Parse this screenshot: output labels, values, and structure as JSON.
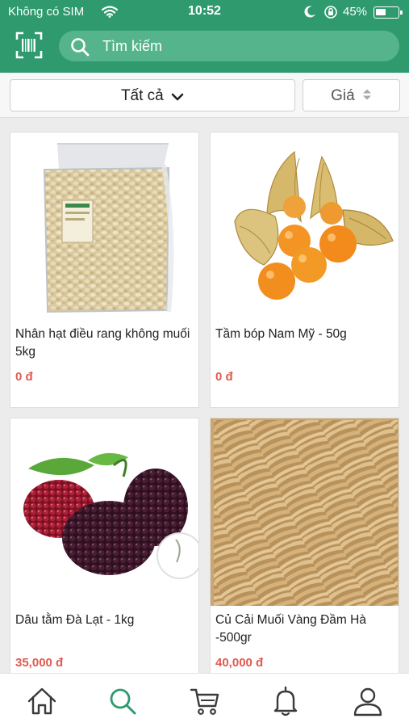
{
  "status_bar": {
    "carrier": "Không có SIM",
    "time": "10:52",
    "battery": "45%",
    "battery_level": 0.45
  },
  "header": {
    "search_placeholder": "Tìm kiếm",
    "scan_icon": "barcode-scan-icon",
    "search_icon": "search-icon"
  },
  "filters": {
    "category_label": "Tất cả",
    "price_label": "Giá"
  },
  "products": [
    {
      "name": "Nhân hạt điều rang không muối 5kg",
      "price": "0 đ",
      "image": "cashew-bag-image"
    },
    {
      "name": "Tầm bóp Nam Mỹ - 50g",
      "price": "0 đ",
      "image": "physalis-image"
    },
    {
      "name": "Dâu tằm Đà Lạt - 1kg",
      "price": "35,000 đ",
      "image": "mulberry-image"
    },
    {
      "name": "Củ Cải Muối Vàng Đầm Hà -500gr",
      "price": "40,000 đ",
      "image": "pickled-radish-image"
    }
  ],
  "bottom_nav": [
    {
      "name": "home-icon",
      "active": false
    },
    {
      "name": "search-icon",
      "active": true
    },
    {
      "name": "cart-icon",
      "active": false
    },
    {
      "name": "bell-icon",
      "active": false
    },
    {
      "name": "user-icon",
      "active": false
    }
  ],
  "colors": {
    "primary": "#2e9a6e",
    "search_bg": "#55b48c",
    "price": "#e05a4f",
    "active_nav": "#2e9a6e"
  }
}
